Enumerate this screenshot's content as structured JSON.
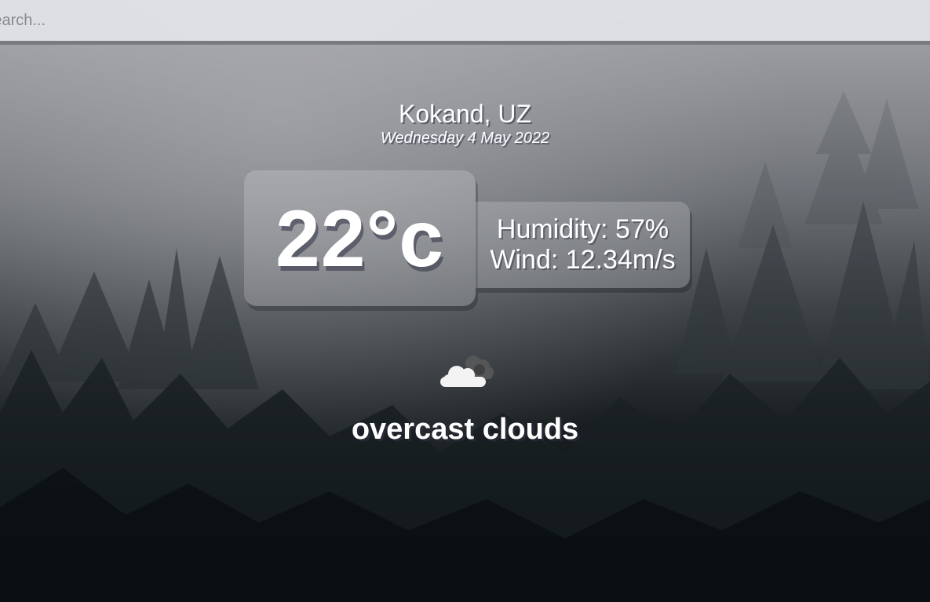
{
  "search": {
    "placeholder": "Search...",
    "value": ""
  },
  "location": {
    "city_country": "Kokand, UZ",
    "date": "Wednesday 4 May 2022"
  },
  "weather": {
    "temperature": "22°c",
    "humidity": "Humidity: 57%",
    "wind": "Wind: 12.34m/s",
    "icon": "overcast-clouds-icon",
    "description": "overcast clouds"
  },
  "colors": {
    "panel": "#ffffff2e",
    "text": "#ffffff"
  }
}
